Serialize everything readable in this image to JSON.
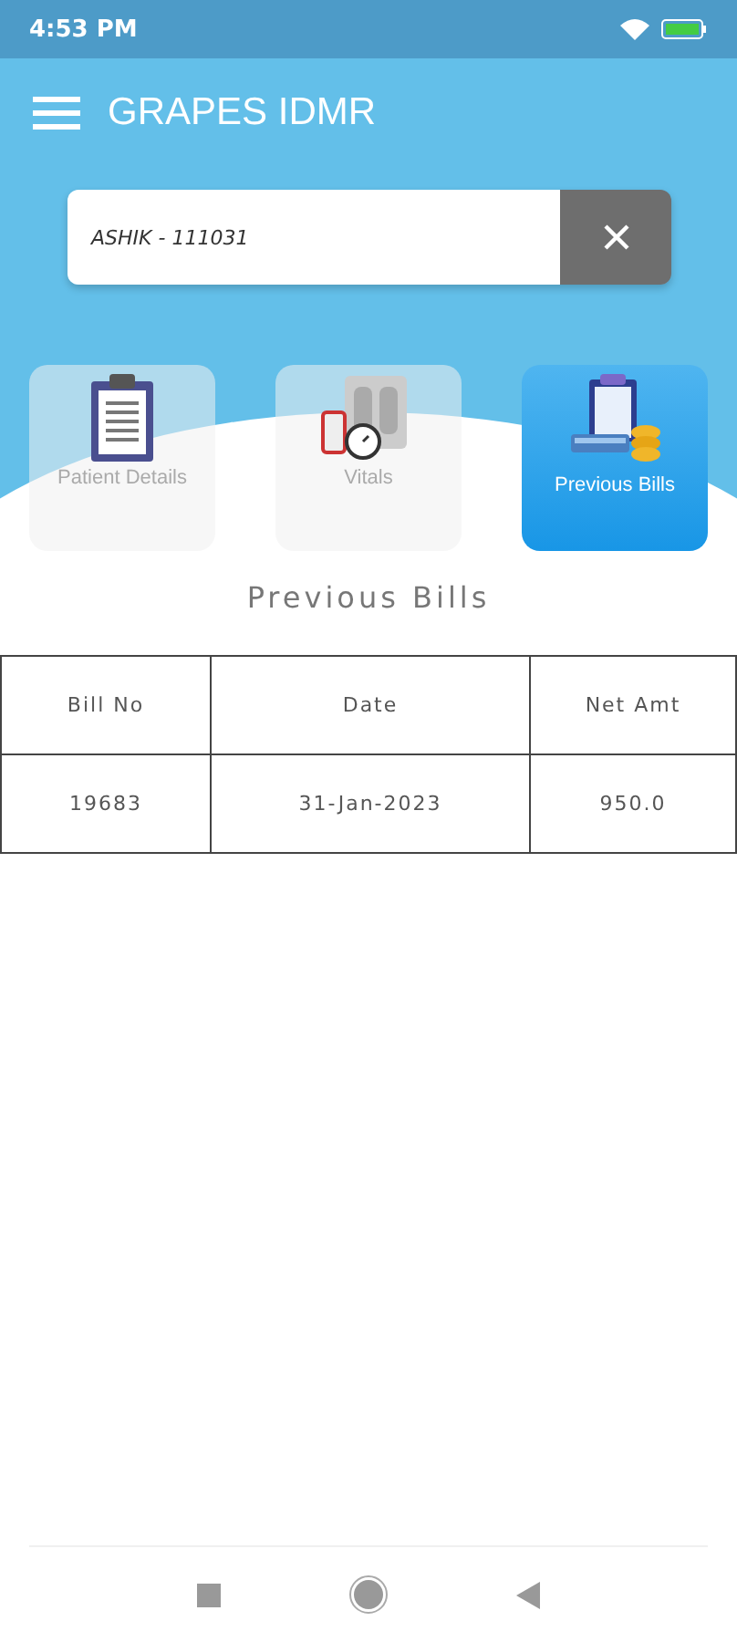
{
  "status_bar": {
    "time": "4:53 PM"
  },
  "app_bar": {
    "title": "GRAPES IDMR"
  },
  "search": {
    "value": "ASHIK - 111031"
  },
  "tiles": [
    {
      "label": "Patient Details",
      "kind": "clipboard",
      "selected": false
    },
    {
      "label": "Vitals",
      "kind": "vitals",
      "selected": false
    },
    {
      "label": "Previous Bills",
      "kind": "bills",
      "selected": true
    }
  ],
  "section_title": "Previous Bills",
  "table": {
    "columns": [
      "Bill No",
      "Date",
      "Net Amt"
    ],
    "rows": [
      [
        "19683",
        "31-Jan-2023",
        "950.0"
      ]
    ]
  }
}
